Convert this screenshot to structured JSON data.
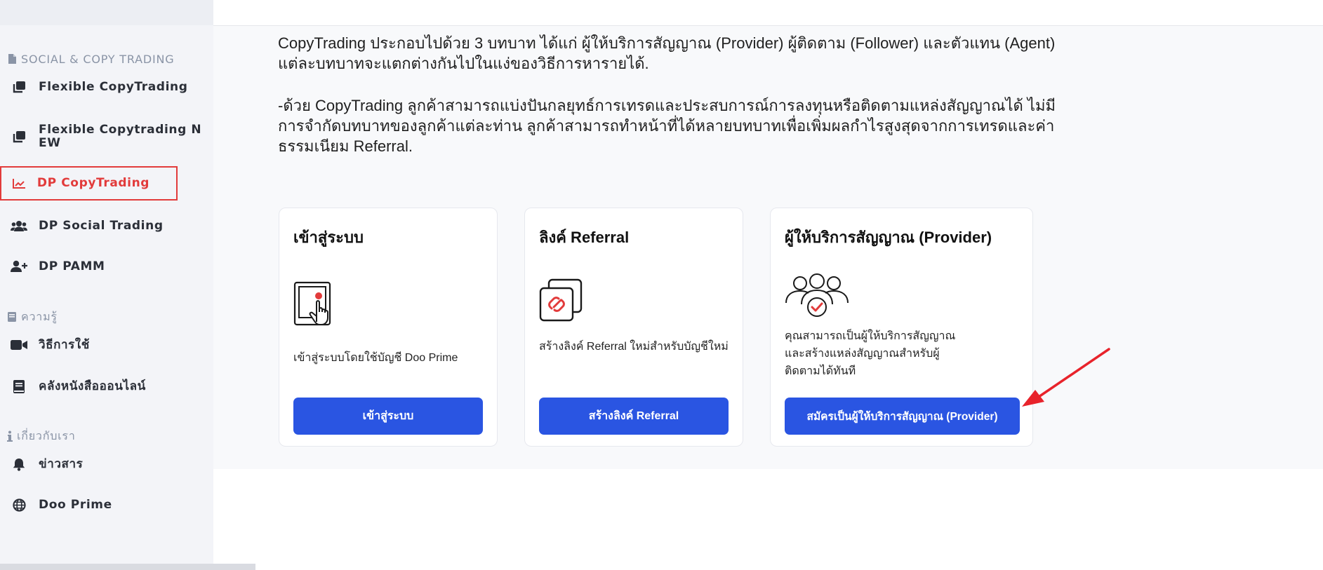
{
  "sidebar": {
    "sections": [
      {
        "label": "SOCIAL & COPY TRADING",
        "icon": "document-icon"
      },
      {
        "label": "ความรู้",
        "icon": "book-icon"
      },
      {
        "label": "เกี่ยวกับเรา",
        "icon": "info-icon"
      }
    ],
    "items": [
      {
        "label": "Flexible CopyTrading",
        "icon": "copy-icon"
      },
      {
        "label": "Flexible Copytrading NEW",
        "icon": "copy-icon"
      },
      {
        "label": "DP CopyTrading",
        "icon": "chart-line-icon",
        "active": true
      },
      {
        "label": "DP Social Trading",
        "icon": "users-icon"
      },
      {
        "label": "DP PAMM",
        "icon": "user-plus-icon"
      },
      {
        "label": "วิธีการใช้",
        "icon": "video-icon"
      },
      {
        "label": "คลังหนังสือออนไลน์",
        "icon": "book-icon"
      },
      {
        "label": "ข่าวสาร",
        "icon": "bell-icon"
      },
      {
        "label": "Doo Prime",
        "icon": "globe-icon"
      }
    ]
  },
  "intro": {
    "paragraph1": "CopyTrading ประกอบไปด้วย 3 บทบาท ได้แก่ ผู้ให้บริการสัญญาณ (Provider) ผู้ติดตาม (Follower) และตัวแทน (Agent) แต่ละบทบาทจะแตกต่างกันไปในแง่ของวิธีการหารายได้.",
    "paragraph2": "-ด้วย CopyTrading ลูกค้าสามารถแบ่งปันกลยุทธ์การเทรดและประสบการณ์การลงทุนหรือติดตามแหล่งสัญญาณได้ ไม่มีการจำกัดบทบาทของลูกค้าแต่ละท่าน ลูกค้าสามารถทำหน้าที่ได้หลายบทบาทเพื่อเพิ่มผลกำไรสูงสุดจากการเทรดและค่าธรรมเนียม Referral."
  },
  "cards": [
    {
      "title": "เข้าสู่ระบบ",
      "icon": "touch-screen-icon",
      "description": "เข้าสู่ระบบโดยใช้บัญชี Doo Prime",
      "button": "เข้าสู่ระบบ"
    },
    {
      "title": "ลิงค์ Referral",
      "icon": "link-icon",
      "description": "สร้างลิงค์ Referral ใหม่สำหรับบัญชีใหม่",
      "button": "สร้างลิงค์ Referral"
    },
    {
      "title": "ผู้ให้บริการสัญญาณ (Provider)",
      "icon": "group-check-icon",
      "description": "คุณสามารถเป็นผู้ให้บริการสัญญาณและสร้างแหล่งสัญญาณสำหรับผู้ติดตามได้ทันที",
      "button": "สมัครเป็นผู้ให้บริการสัญญาณ (Provider)"
    }
  ],
  "colors": {
    "accent": "#2a55e2",
    "active": "#e23b3b",
    "annotation_arrow": "#e8232b"
  }
}
